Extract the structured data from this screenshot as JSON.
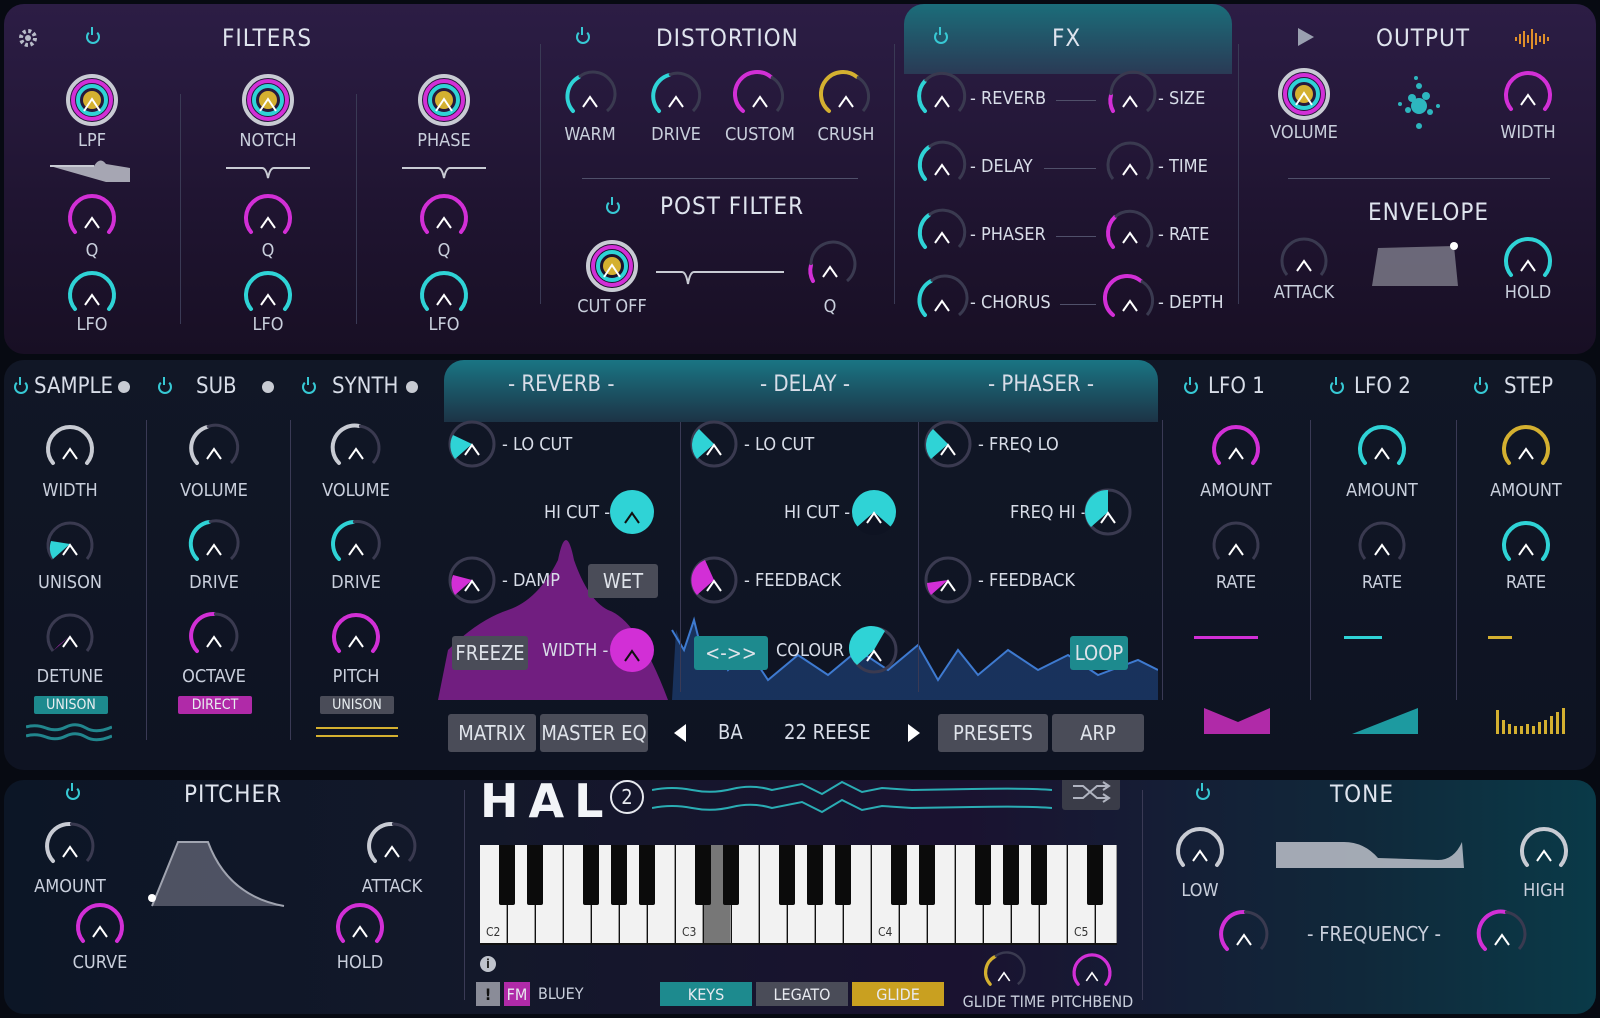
{
  "colors": {
    "cyan": "#2fd3d6",
    "magenta": "#d22fd6",
    "yellow": "#d4b030",
    "gray": "#c8cbd3"
  },
  "top": {
    "filters": {
      "title": "FILTERS",
      "cols": [
        {
          "name": "LPF",
          "q": "Q",
          "lfo": "LFO"
        },
        {
          "name": "NOTCH",
          "q": "Q",
          "lfo": "LFO"
        },
        {
          "name": "PHASE",
          "q": "Q",
          "lfo": "LFO"
        }
      ]
    },
    "distortion": {
      "title": "DISTORTION",
      "knobs": [
        "WARM",
        "DRIVE",
        "CUSTOM",
        "CRUSH"
      ]
    },
    "post_filter": {
      "title": "POST FILTER",
      "cutoff": "CUT OFF",
      "q": "Q"
    },
    "fx": {
      "title": "FX",
      "left": [
        "- REVERB",
        "- DELAY",
        "- PHASER",
        "- CHORUS"
      ],
      "right": [
        "- SIZE",
        "- TIME",
        "- RATE",
        "- DEPTH"
      ]
    },
    "output": {
      "title": "OUTPUT",
      "volume": "VOLUME",
      "width": "WIDTH"
    },
    "envelope": {
      "title": "ENVELOPE",
      "attack": "ATTACK",
      "hold": "HOLD"
    }
  },
  "mid": {
    "osc": [
      {
        "title": "SAMPLE",
        "k1": "WIDTH",
        "k2": "UNISON",
        "k3": "DETUNE",
        "badge": "UNISON"
      },
      {
        "title": "SUB",
        "k1": "VOLUME",
        "k2": "DRIVE",
        "k3": "OCTAVE",
        "badge": "DIRECT"
      },
      {
        "title": "SYNTH",
        "k1": "VOLUME",
        "k2": "DRIVE",
        "k3": "PITCH",
        "badge": "UNISON"
      }
    ],
    "fx_tabs": [
      "- REVERB -",
      "- DELAY -",
      "- PHASER -"
    ],
    "reverb": {
      "locut": "- LO CUT",
      "hicut": "HI CUT -",
      "damp": "- DAMP",
      "wet": "WET",
      "freeze": "FREEZE",
      "width": "WIDTH -"
    },
    "delay": {
      "locut": "- LO CUT",
      "hicut": "HI CUT -",
      "feedback": "- FEEDBACK",
      "pingpong": "<->>",
      "colour": "COLOUR -"
    },
    "phaser": {
      "freqlo": "- FREQ LO",
      "freqhi": "FREQ HI -",
      "feedback": "- FEEDBACK",
      "loop": "LOOP"
    },
    "mods": [
      {
        "title": "LFO 1",
        "amount": "AMOUNT",
        "rate": "RATE"
      },
      {
        "title": "LFO 2",
        "amount": "AMOUNT",
        "rate": "RATE"
      },
      {
        "title": "STEP",
        "amount": "AMOUNT",
        "rate": "RATE"
      }
    ],
    "bar": {
      "matrix": "MATRIX",
      "mastereq": "MASTER EQ",
      "bank": "BA",
      "preset": "22 REESE",
      "presets": "PRESETS",
      "arp": "ARP"
    }
  },
  "bot": {
    "pitcher": {
      "title": "PITCHER",
      "amount": "AMOUNT",
      "attack": "ATTACK",
      "curve": "CURVE",
      "hold": "HOLD"
    },
    "logo": "HAL",
    "logo_num": "2",
    "keys": [
      "C2",
      "C3",
      "C4",
      "C5"
    ],
    "fm": "FM",
    "excl": "!",
    "patch_name": "BLUEY",
    "modes": [
      "KEYS",
      "LEGATO",
      "GLIDE"
    ],
    "glide_time": "GLIDE TIME",
    "pitchbend": "PITCHBEND",
    "tone": {
      "title": "TONE",
      "low": "LOW",
      "high": "HIGH",
      "frequency": "- FREQUENCY -"
    }
  }
}
